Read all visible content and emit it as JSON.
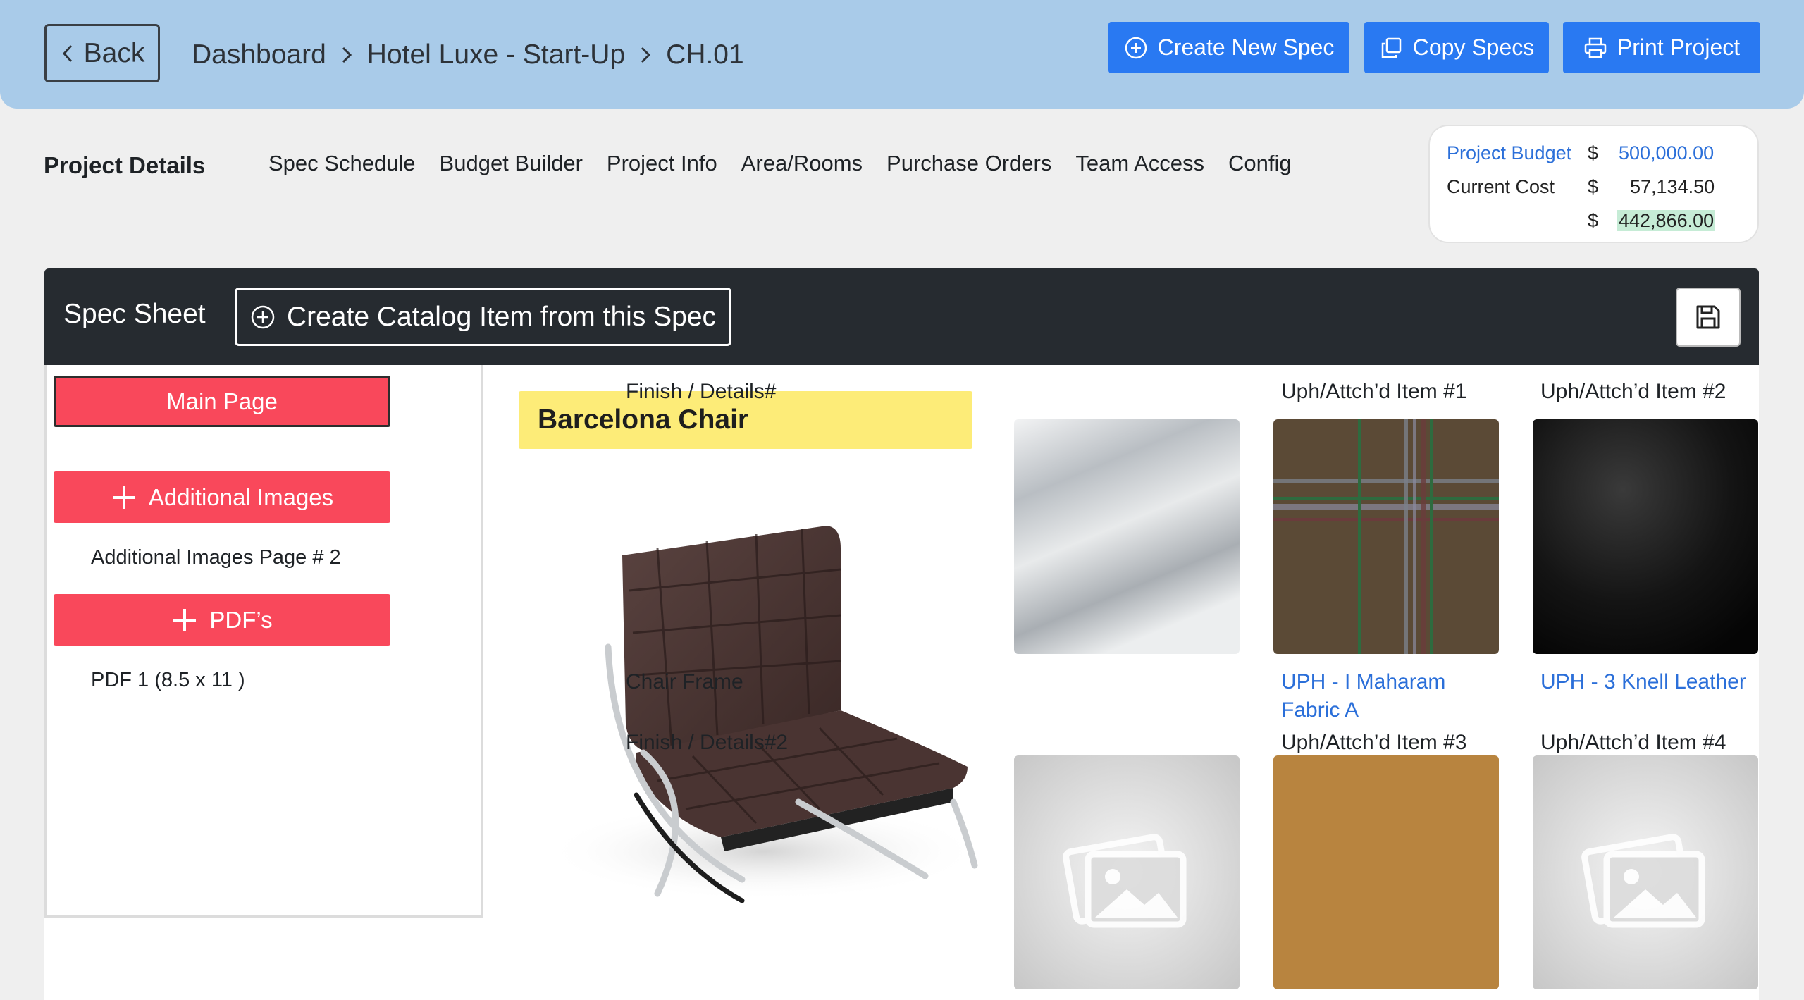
{
  "header": {
    "back_label": "Back",
    "breadcrumb": [
      "Dashboard",
      "Hotel Luxe - Start-Up",
      "CH.01"
    ],
    "buttons": {
      "create_new_spec": "Create New Spec",
      "copy_specs": "Copy Specs",
      "print_project": "Print Project"
    }
  },
  "nav": {
    "title": "Project Details",
    "tabs": [
      "Spec Schedule",
      "Budget Builder",
      "Project Info",
      "Area/Rooms",
      "Purchase Orders",
      "Team Access",
      "Config"
    ]
  },
  "budget": {
    "project_budget_label": "Project Budget",
    "project_budget_currency": "$",
    "project_budget_value": "500,000.00",
    "current_cost_label": "Current Cost",
    "current_cost_currency": "$",
    "current_cost_value": "57,134.50",
    "remaining_currency": "$",
    "remaining_value": "442,866.00"
  },
  "spec_sheet": {
    "title": "Spec Sheet",
    "create_catalog_label": "Create Catalog Item from this Spec"
  },
  "sidebar": {
    "main_page": "Main Page",
    "additional_images": "Additional Images",
    "additional_images_page": "Additional Images Page # 2",
    "pdfs": "PDF’s",
    "pdf_1": "PDF 1 (8.5 x 11 )"
  },
  "product": {
    "name": "Barcelona Chair"
  },
  "materials": {
    "slot1": {
      "heading": "Finish / Details#",
      "caption": "Chair Frame"
    },
    "slot2": {
      "heading": "Uph/Attch’d Item #1",
      "caption_line1": "UPH - I Maharam",
      "caption_line2": "Fabric A"
    },
    "slot3": {
      "heading": "Uph/Attch’d Item #2",
      "caption": "UPH - 3 Knell Leather"
    },
    "slot4": {
      "heading": "Finish / Details#2"
    },
    "slot5": {
      "heading": "Uph/Attch’d Item #3",
      "color": "#b8843f"
    },
    "slot6": {
      "heading": "Uph/Attch’d Item #4"
    }
  },
  "colors": {
    "header_bg": "#a9cbe9",
    "primary_button": "#2979f2",
    "accent_red": "#f9485b",
    "title_highlight": "#fdec78",
    "dark_bar": "#262b30"
  }
}
